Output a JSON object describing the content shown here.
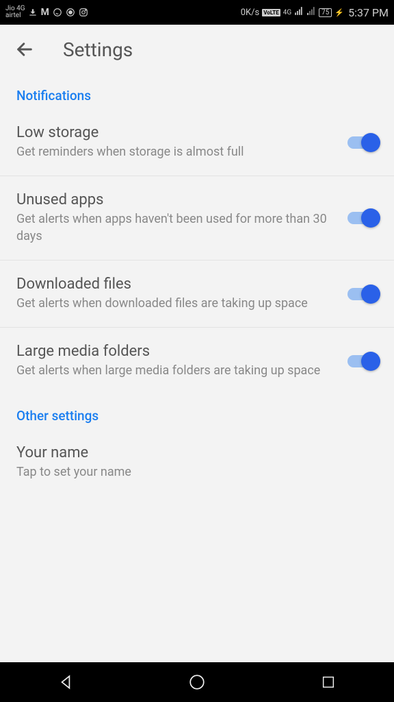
{
  "statusbar": {
    "carrier_line1": "Jio 4G",
    "carrier_line2": "airtel",
    "speed": "0K/s",
    "volte": "VoLTE",
    "net": "4G",
    "battery": "75",
    "time": "5:37 PM"
  },
  "appbar": {
    "title": "Settings"
  },
  "sections": {
    "notifications": {
      "header": "Notifications",
      "low_storage": {
        "title": "Low storage",
        "desc": "Get reminders when storage is almost full"
      },
      "unused_apps": {
        "title": "Unused apps",
        "desc": "Get alerts when apps haven't been used for more than 30 days"
      },
      "downloaded_files": {
        "title": "Downloaded files",
        "desc": "Get alerts when downloaded files are taking up space"
      },
      "large_media": {
        "title": "Large media folders",
        "desc": "Get alerts when large media folders are taking up space"
      }
    },
    "other": {
      "header": "Other settings",
      "your_name": {
        "title": "Your name",
        "desc": "Tap to set your name"
      }
    }
  }
}
